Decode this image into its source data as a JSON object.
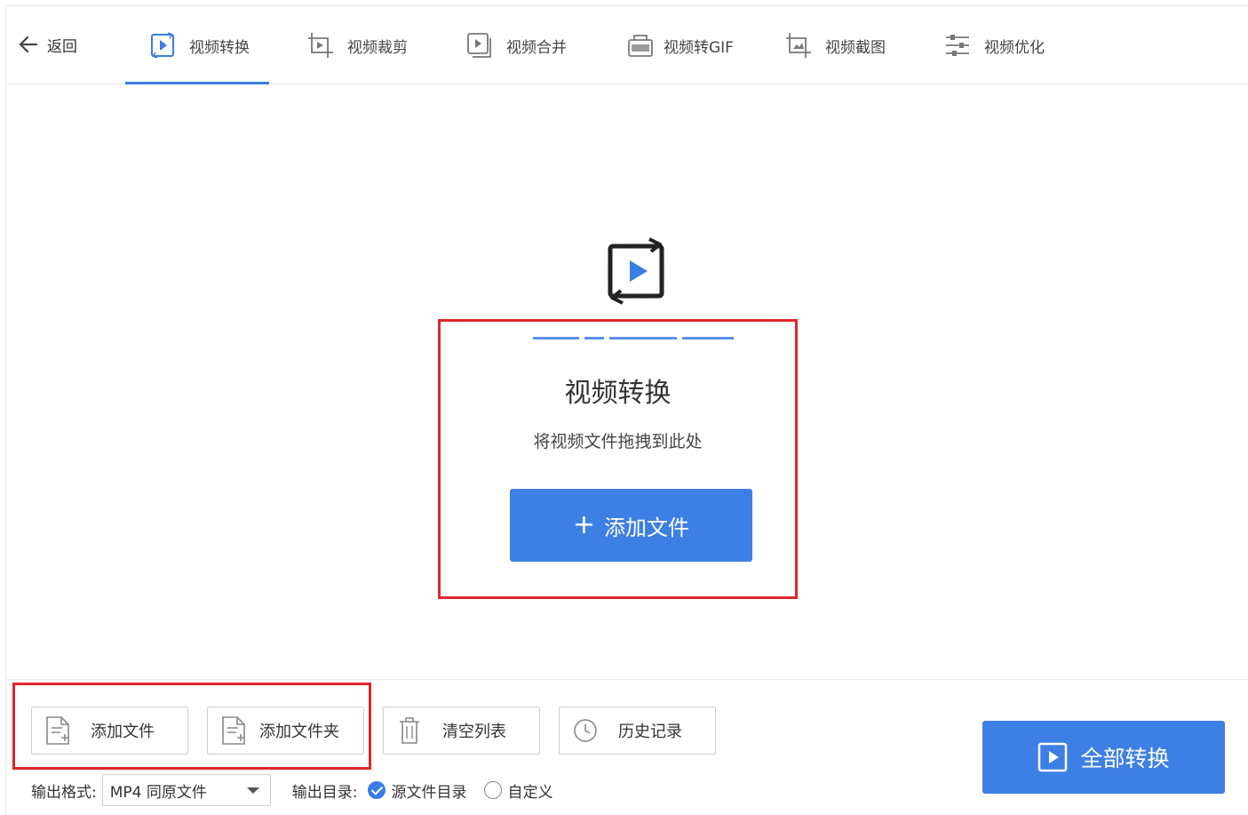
{
  "nav": {
    "back_label": "返回",
    "tabs": [
      {
        "label": "视频转换",
        "icon": "video-convert-icon",
        "active": true
      },
      {
        "label": "视频裁剪",
        "icon": "video-crop-icon",
        "active": false
      },
      {
        "label": "视频合并",
        "icon": "video-merge-icon",
        "active": false
      },
      {
        "label": "视频转GIF",
        "icon": "gif-icon",
        "active": false
      },
      {
        "label": "视频截图",
        "icon": "screenshot-icon",
        "active": false
      },
      {
        "label": "视频优化",
        "icon": "sliders-icon",
        "active": false
      }
    ]
  },
  "dropzone": {
    "title": "视频转换",
    "subtitle": "将视频文件拖拽到此处",
    "add_button": "添加文件"
  },
  "toolbar": {
    "add_file": "添加文件",
    "add_folder": "添加文件夹",
    "clear_list": "清空列表",
    "history": "历史记录",
    "convert_all": "全部转换"
  },
  "options": {
    "format_label": "输出格式:",
    "format_value": "MP4 同原文件",
    "dir_label": "输出目录:",
    "dir_source": "源文件目录",
    "dir_custom": "自定义"
  },
  "colors": {
    "accent": "#3d7fe4",
    "highlight": "#e0262a"
  }
}
